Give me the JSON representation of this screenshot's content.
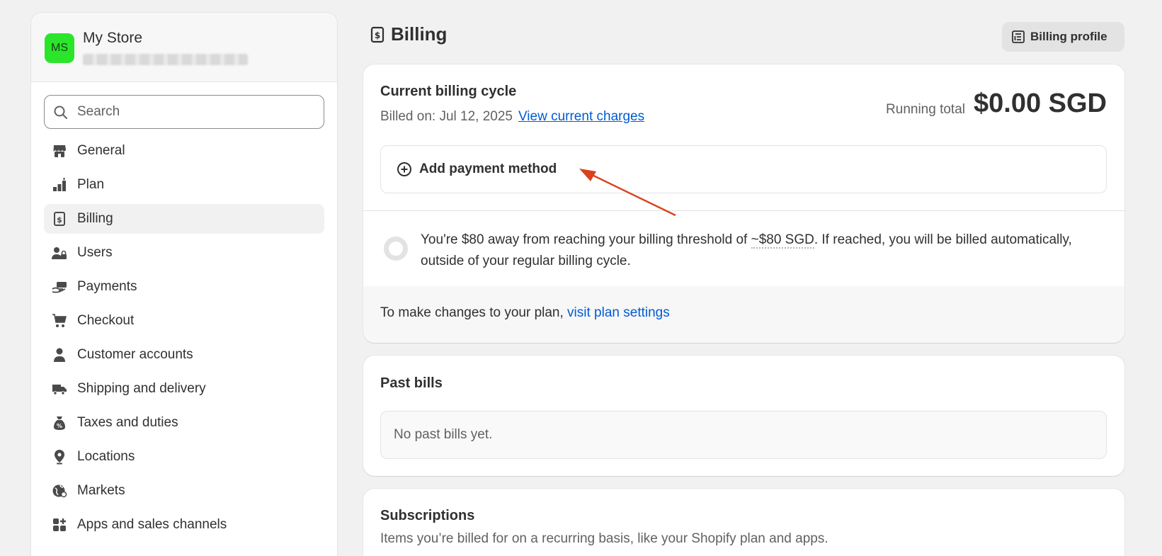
{
  "store": {
    "initials": "MS",
    "name": "My Store",
    "domain": ""
  },
  "search": {
    "placeholder": "Search"
  },
  "nav": {
    "items": [
      {
        "label": "General",
        "icon": "store-icon"
      },
      {
        "label": "Plan",
        "icon": "plan-icon"
      },
      {
        "label": "Billing",
        "icon": "receipt-icon",
        "active": true
      },
      {
        "label": "Users",
        "icon": "users-icon"
      },
      {
        "label": "Payments",
        "icon": "payments-icon"
      },
      {
        "label": "Checkout",
        "icon": "cart-icon"
      },
      {
        "label": "Customer accounts",
        "icon": "person-icon"
      },
      {
        "label": "Shipping and delivery",
        "icon": "truck-icon"
      },
      {
        "label": "Taxes and duties",
        "icon": "tax-bag-icon"
      },
      {
        "label": "Locations",
        "icon": "location-pin-icon"
      },
      {
        "label": "Markets",
        "icon": "globe-icon"
      },
      {
        "label": "Apps and sales channels",
        "icon": "apps-icon"
      }
    ]
  },
  "header": {
    "title": "Billing",
    "profile_button": "Billing profile"
  },
  "cycle": {
    "title": "Current billing cycle",
    "billed_on": "Billed on: Jul 12, 2025",
    "view_charges": "View current charges",
    "running_label": "Running total",
    "running_total": "$0.00 SGD",
    "add_payment": "Add payment method",
    "threshold_pre": "You're $80 away from reaching your billing threshold of ",
    "threshold_amount": "~$80 SGD",
    "threshold_post": ". If reached, you will be billed automatically, outside of your regular billing cycle.",
    "plan_text": "To make changes to your plan, ",
    "plan_link": "visit plan settings"
  },
  "past_bills": {
    "title": "Past bills",
    "empty": "No past bills yet."
  },
  "subscriptions": {
    "title": "Subscriptions",
    "description": "Items you’re billed for on a recurring basis, like your Shopify plan and apps."
  },
  "colors": {
    "accent": "#005bd3",
    "avatar": "#2be52b",
    "arrow": "#d9421d"
  }
}
